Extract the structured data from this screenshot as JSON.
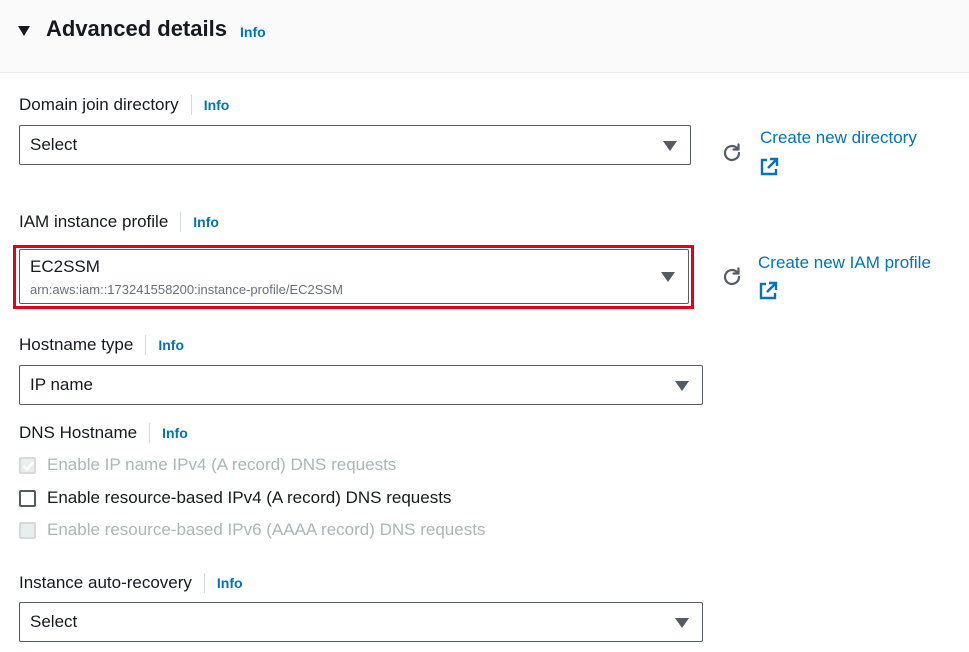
{
  "header": {
    "title": "Advanced details",
    "info": "Info"
  },
  "domain_join": {
    "label": "Domain join directory",
    "info": "Info",
    "value": "Select",
    "create_link": "Create new directory"
  },
  "iam_profile": {
    "label": "IAM instance profile",
    "info": "Info",
    "value": "EC2SSM",
    "arn": "arn:aws:iam::173241558200:instance-profile/EC2SSM",
    "create_link": "Create new IAM profile",
    "highlight_color": "#e3001b"
  },
  "hostname_type": {
    "label": "Hostname type",
    "info": "Info",
    "value": "IP name"
  },
  "dns_hostname": {
    "label": "DNS Hostname",
    "info": "Info",
    "options": [
      {
        "label": "Enable IP name IPv4 (A record) DNS requests",
        "checked": true,
        "disabled": true
      },
      {
        "label": "Enable resource-based IPv4 (A record) DNS requests",
        "checked": false,
        "disabled": false
      },
      {
        "label": "Enable resource-based IPv6 (AAAA record) DNS requests",
        "checked": false,
        "disabled": true
      }
    ]
  },
  "auto_recovery": {
    "label": "Instance auto-recovery",
    "info": "Info",
    "value": "Select"
  },
  "colors": {
    "link": "#0073bb",
    "text": "#16191f",
    "disabled": "#aab7b8"
  }
}
